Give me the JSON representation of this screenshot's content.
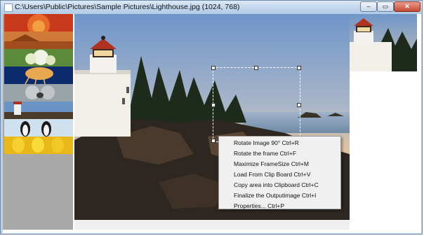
{
  "window": {
    "title": "C:\\Users\\Public\\Pictures\\Sample Pictures\\Lighthouse.jpg (1024, 768)",
    "controls": {
      "minimize": "–",
      "maximize": "▭",
      "close": "✕"
    }
  },
  "thumbnails": [
    "Chrysanthemum",
    "Desert",
    "Hydrangeas",
    "Jellyfish",
    "Koala",
    "Lighthouse",
    "Penguins",
    "Tulips"
  ],
  "context_menu": {
    "items": [
      "Rotate Image 90°  Ctrl+R",
      "Rotate the frame  Ctrl+F",
      "Maximize FrameSize  Ctrl+M",
      "Load From Clip Board  Ctrl+V",
      "Copy area into Clipboard  Ctrl+C",
      "Finalize the Outputimage  Ctrl+I",
      "Properties...  Ctrl+P"
    ]
  },
  "colors": {
    "titlebar": "#c4d8ee",
    "sidebar": "#a9a9a9",
    "menu_bg": "#f0f0f0",
    "close_button": "#c64a33"
  }
}
